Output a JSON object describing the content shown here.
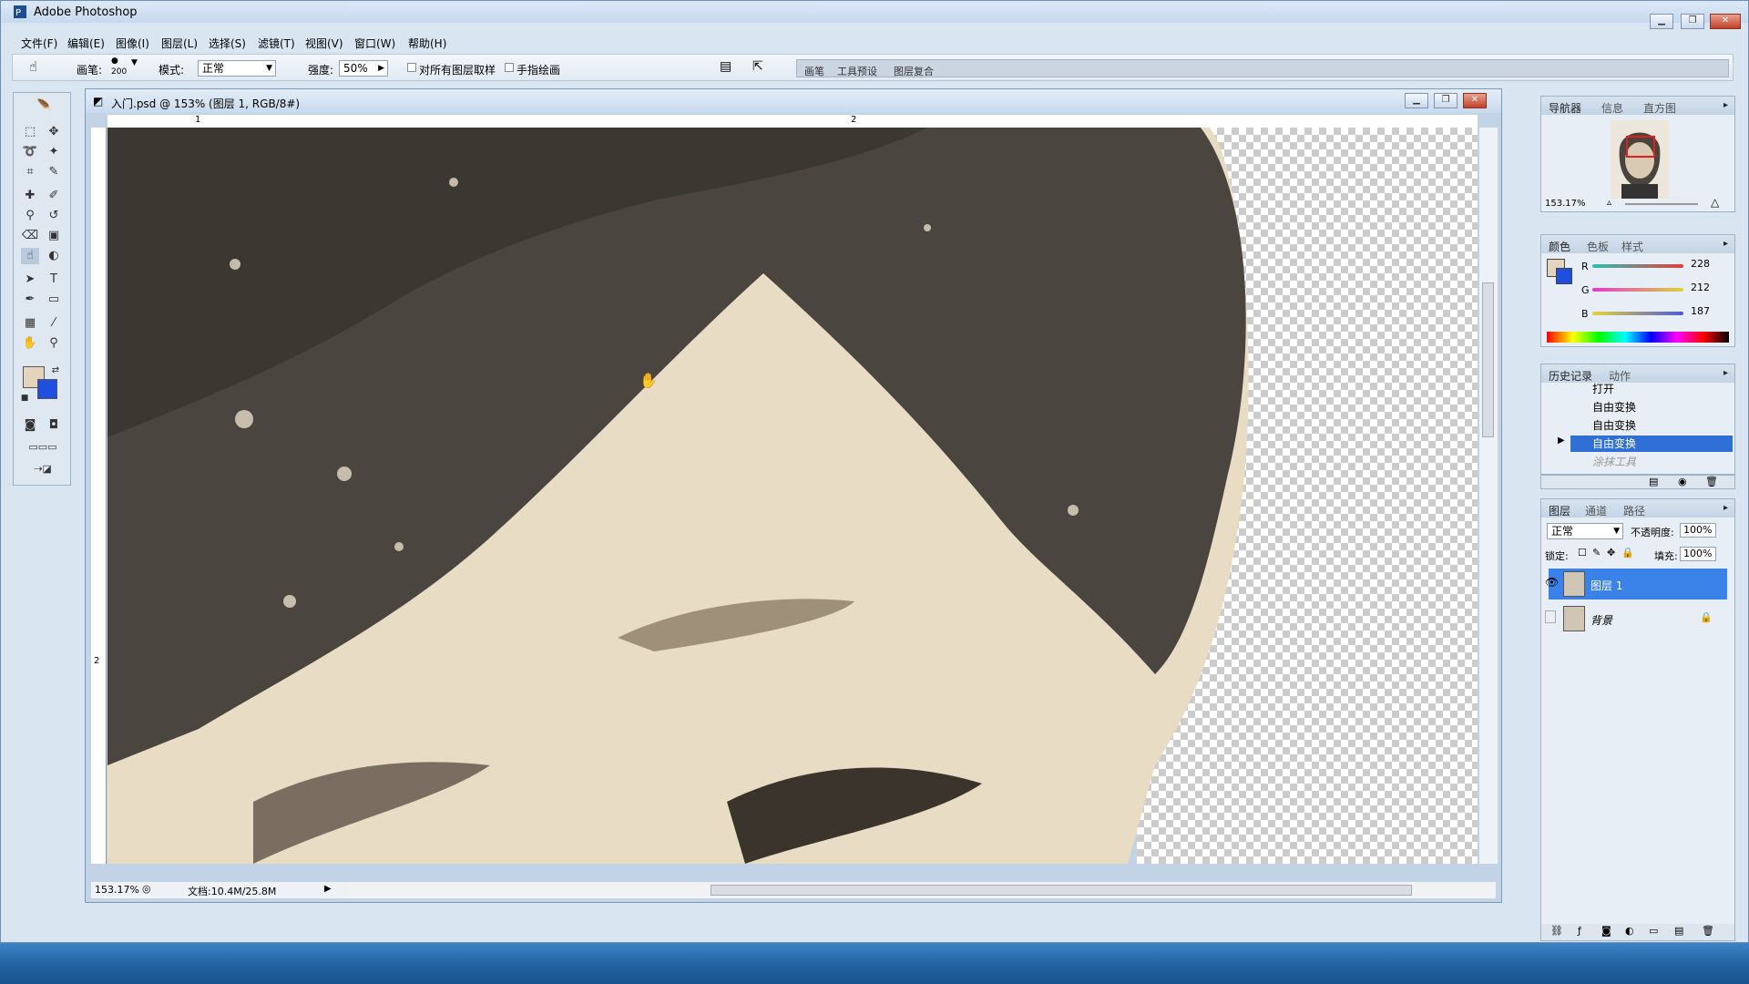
{
  "app": {
    "title": "Adobe Photoshop"
  },
  "menu": [
    "文件(F)",
    "编辑(E)",
    "图像(I)",
    "图层(L)",
    "选择(S)",
    "滤镜(T)",
    "视图(V)",
    "窗口(W)",
    "帮助(H)"
  ],
  "options": {
    "brush_label": "画笔:",
    "brush_size": "200",
    "mode_label": "模式:",
    "mode_value": "正常",
    "strength_label": "强度:",
    "strength_value": "50%",
    "sample_all_label": "对所有图层取样",
    "finger_paint_label": "手指绘画",
    "well_tabs": [
      "画笔",
      "工具预设",
      "图层复合"
    ]
  },
  "document": {
    "title": "入门.psd @ 153% (图层 1, RGB/8#)",
    "ruler_h": [
      "1",
      "2"
    ],
    "ruler_v": [
      "2"
    ],
    "zoom": "153.17%",
    "doc_size": "文档:10.4M/25.8M"
  },
  "navigator": {
    "tabs": [
      "导航器",
      "信息",
      "直方图"
    ],
    "zoom": "153.17%"
  },
  "color": {
    "tabs": [
      "颜色",
      "色板",
      "样式"
    ],
    "channels": [
      {
        "name": "R",
        "value": "228"
      },
      {
        "name": "G",
        "value": "212"
      },
      {
        "name": "B",
        "value": "187"
      }
    ],
    "foreground": "#e4d4bb",
    "background": "#1f4fe0"
  },
  "history": {
    "tabs": [
      "历史记录",
      "动作"
    ],
    "items": [
      "打开",
      "自由变换",
      "自由变换",
      "自由变换",
      "涂抹工具"
    ],
    "selected_index": 3
  },
  "layers": {
    "tabs": [
      "图层",
      "通道",
      "路径"
    ],
    "blend_mode": "正常",
    "opacity_label": "不透明度:",
    "opacity_value": "100%",
    "lock_label": "锁定:",
    "fill_label": "填充:",
    "fill_value": "100%",
    "items": [
      {
        "name": "图层 1",
        "visible": true,
        "selected": true
      },
      {
        "name": "背景",
        "visible": false,
        "selected": false,
        "locked": true
      }
    ]
  }
}
